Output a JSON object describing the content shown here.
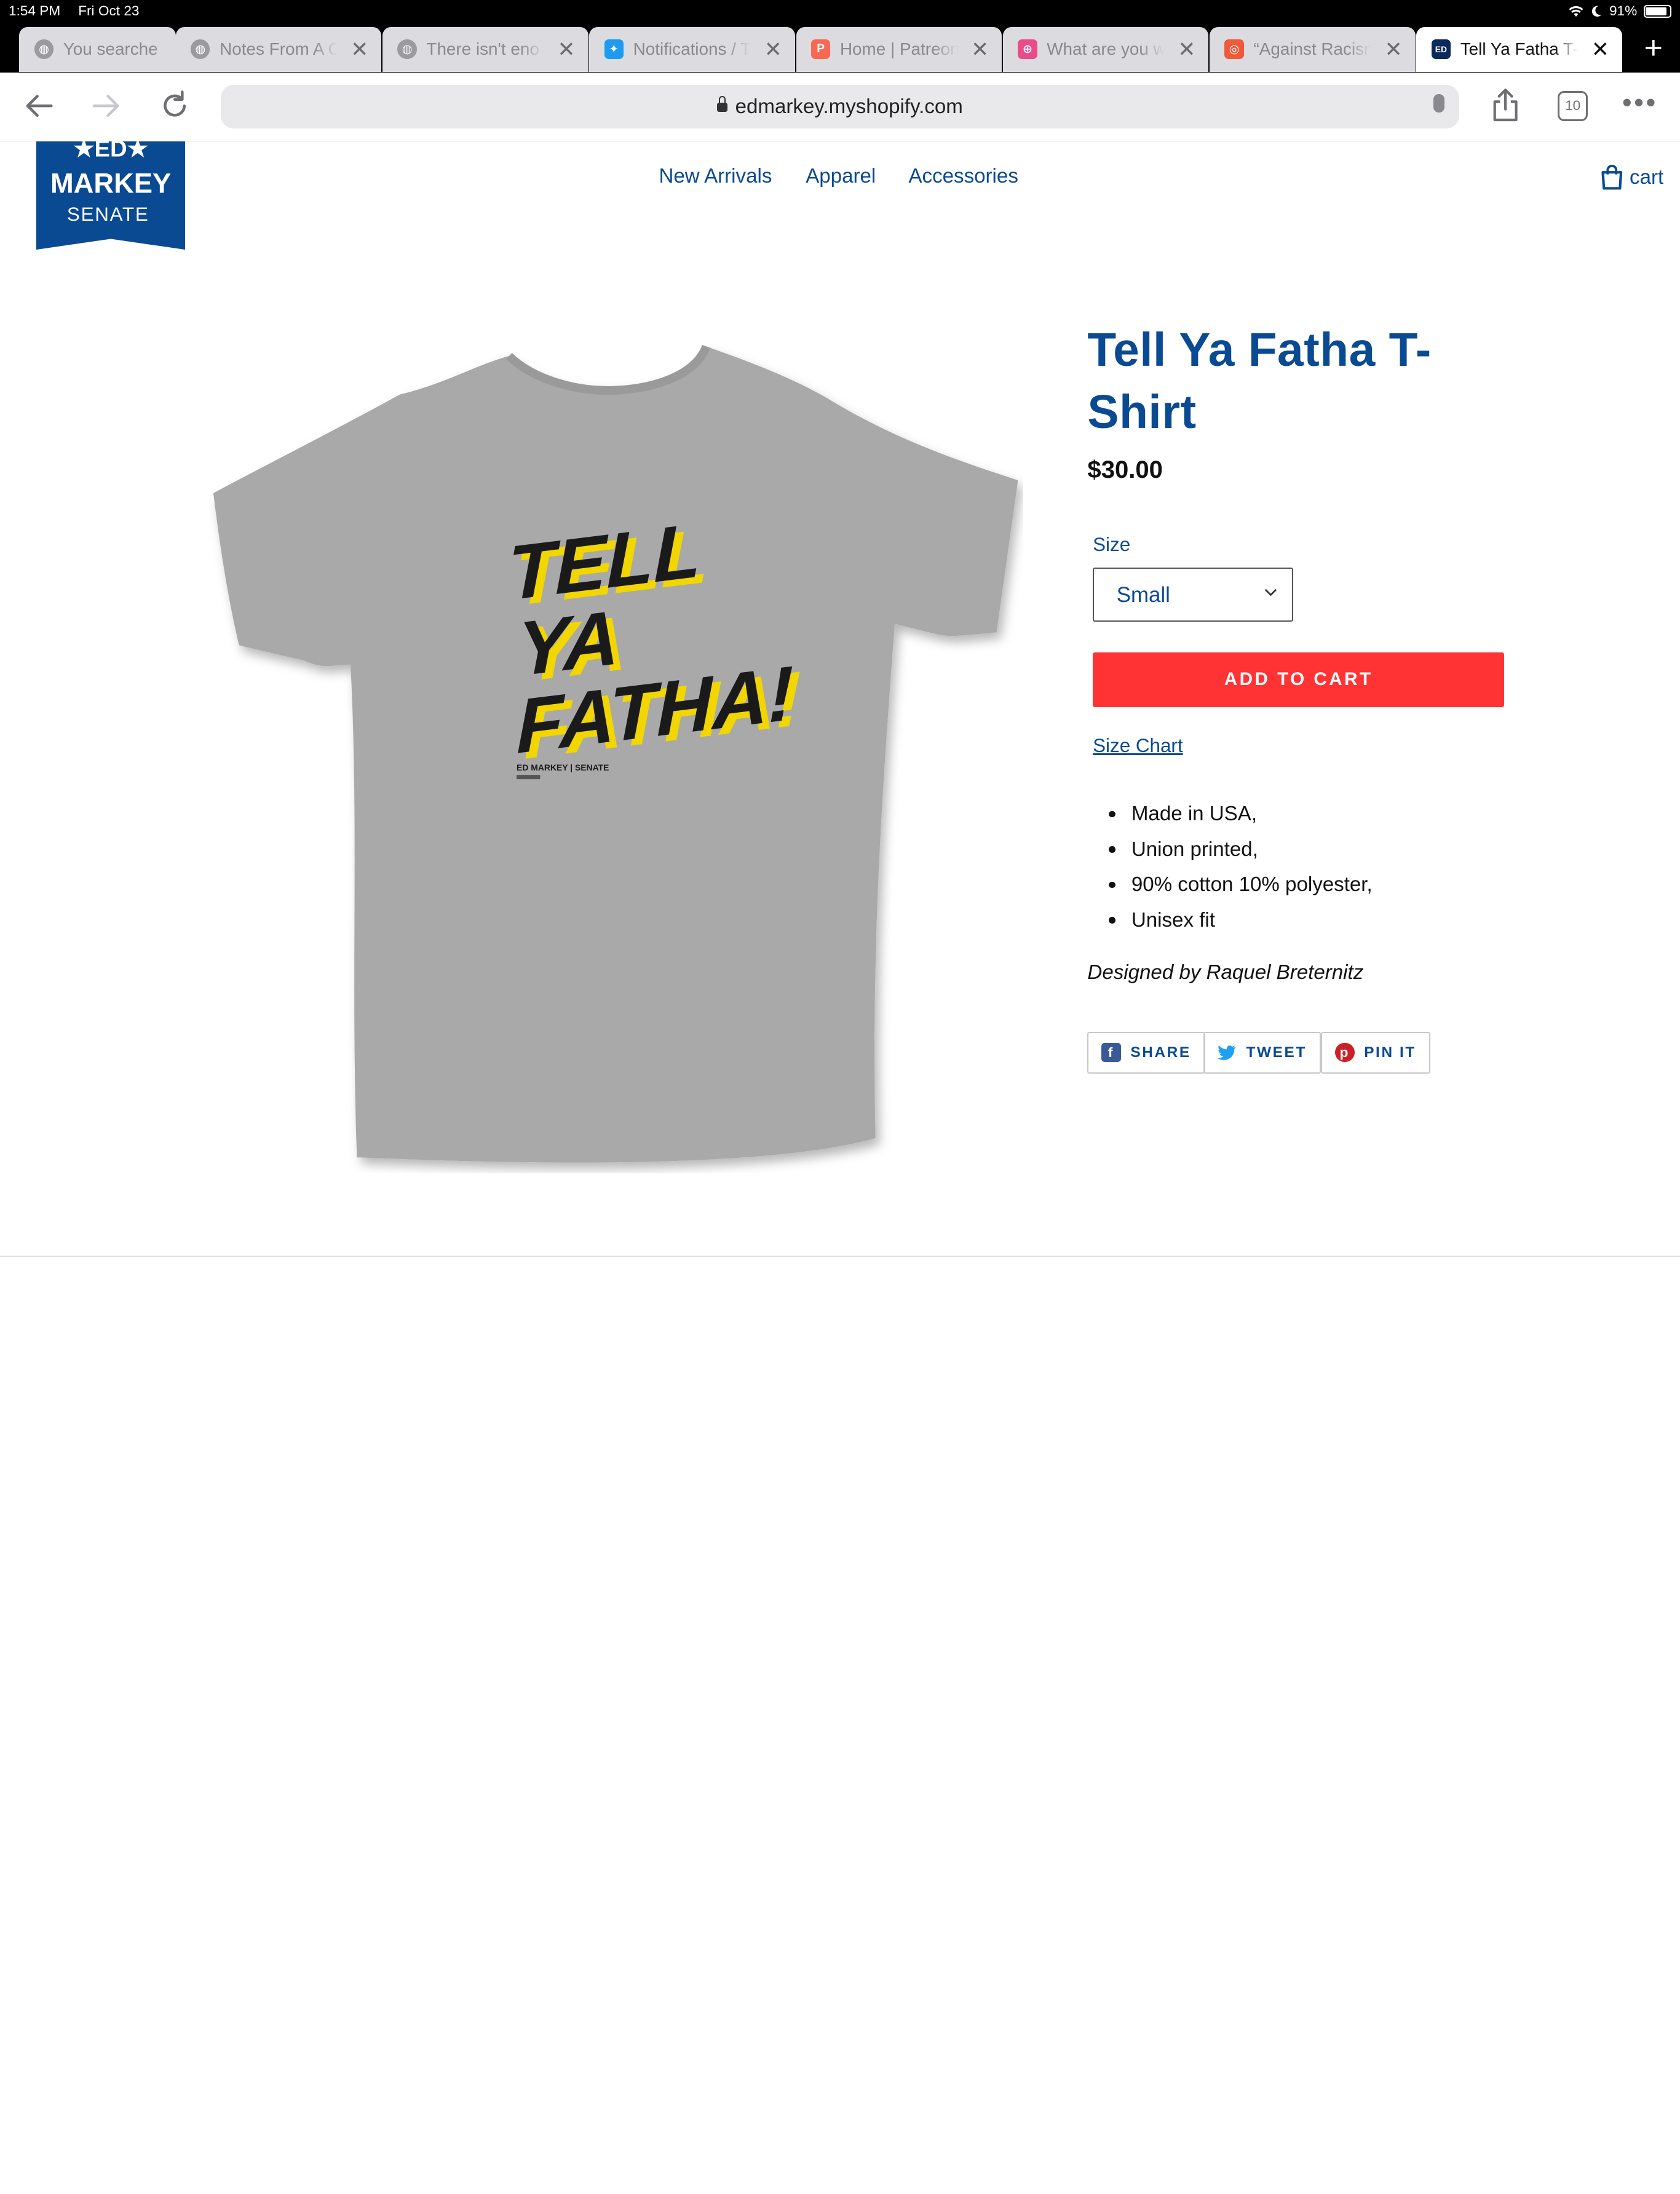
{
  "status_bar": {
    "time": "1:54 PM",
    "date": "Fri Oct 23",
    "battery": "91%"
  },
  "tabs": [
    {
      "label": "You searche",
      "favicon": "globe-icon"
    },
    {
      "label": "Notes From A C",
      "favicon": "globe-icon"
    },
    {
      "label": "There isn't eno",
      "favicon": "globe-icon"
    },
    {
      "label": "Notifications / T",
      "favicon": "twitter-icon"
    },
    {
      "label": "Home | Patreon",
      "favicon": "patreon-icon"
    },
    {
      "label": "What are you w",
      "favicon": "dribbble-icon"
    },
    {
      "label": "“Against Racism",
      "favicon": "site-icon"
    },
    {
      "label": "Tell Ya Fatha T-",
      "favicon": "ed-icon",
      "active": true
    }
  ],
  "toolbar": {
    "url": "edmarkey.myshopify.com",
    "tab_count": "10"
  },
  "site": {
    "logo": {
      "line1": "★ED★",
      "line2": "MARKEY",
      "line3": "SENATE"
    },
    "nav": [
      "New Arrivals",
      "Apparel",
      "Accessories"
    ],
    "cart_label": "cart"
  },
  "product": {
    "title": "Tell Ya Fatha T-Shirt",
    "price": "$30.00",
    "size_label": "Size",
    "size_selected": "Small",
    "add_to_cart": "ADD TO CART",
    "size_chart": "Size Chart",
    "features": [
      "Made in USA,",
      "Union printed,",
      "90% cotton 10% polyester,",
      "Unisex fit"
    ],
    "designer": "Designed by Raquel Breternitz",
    "shirt_print": {
      "line1": "TELL",
      "line2": "YA",
      "line3": "FATHA!",
      "footer": "ED MARKEY | SENATE"
    }
  },
  "share": {
    "share": "SHARE",
    "tweet": "TWEET",
    "pin": "PIN IT"
  },
  "colors": {
    "brand_blue": "#0a4a92",
    "cta_red": "#ff3333",
    "shirt_gray": "#a9a9a9",
    "print_yellow": "#f2d600"
  }
}
